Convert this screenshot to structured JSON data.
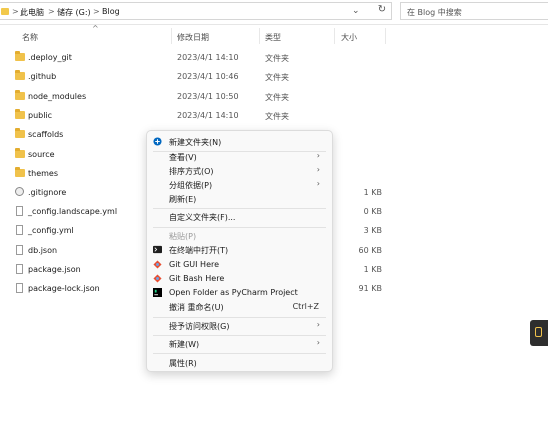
{
  "address": {
    "breadcrumbs": [
      "此电脑",
      "储存 (G:)",
      "Blog"
    ],
    "separator": ">",
    "search_placeholder": "在 Blog 中搜索"
  },
  "columns": {
    "name": "名称",
    "date": "修改日期",
    "type": "类型",
    "size": "大小"
  },
  "files": [
    {
      "name": ".deploy_git",
      "date": "2023/4/1 14:10",
      "type": "文件夹",
      "size": "",
      "kind": "folder"
    },
    {
      "name": ".github",
      "date": "2023/4/1 10:46",
      "type": "文件夹",
      "size": "",
      "kind": "folder"
    },
    {
      "name": "node_modules",
      "date": "2023/4/1 10:50",
      "type": "文件夹",
      "size": "",
      "kind": "folder"
    },
    {
      "name": "public",
      "date": "2023/4/1 14:10",
      "type": "文件夹",
      "size": "",
      "kind": "folder"
    },
    {
      "name": "scaffolds",
      "date": "",
      "type": "",
      "size": "",
      "kind": "folder"
    },
    {
      "name": "source",
      "date": "",
      "type": "",
      "size": "",
      "kind": "folder"
    },
    {
      "name": "themes",
      "date": "",
      "type": "",
      "size": "",
      "kind": "folder"
    },
    {
      "name": ".gitignore",
      "date": "",
      "type": "",
      "size": "1 KB",
      "kind": "gear"
    },
    {
      "name": "_config.landscape.yml",
      "date": "",
      "type": "",
      "size": "0 KB",
      "kind": "doc"
    },
    {
      "name": "_config.yml",
      "date": "",
      "type": "",
      "size": "3 KB",
      "kind": "doc"
    },
    {
      "name": "db.json",
      "date": "",
      "type": "",
      "size": "60 KB",
      "kind": "doc"
    },
    {
      "name": "package.json",
      "date": "",
      "type": "",
      "size": "1 KB",
      "kind": "doc"
    },
    {
      "name": "package-lock.json",
      "date": "",
      "type": "",
      "size": "91 KB",
      "kind": "doc"
    }
  ],
  "context_menu": {
    "new_folder": "新建文件夹(N)",
    "view": "查看(V)",
    "sort": "排序方式(O)",
    "group": "分组依据(P)",
    "refresh": "刷新(E)",
    "customize": "自定义文件夹(F)...",
    "paste": "粘贴(P)",
    "open_terminal": "在终端中打开(T)",
    "git_gui": "Git GUI Here",
    "git_bash": "Git Bash Here",
    "pycharm": "Open Folder as PyCharm Project",
    "undo": "撤消 重命名(U)",
    "undo_shortcut": "Ctrl+Z",
    "access": "授予访问权限(G)",
    "new": "新建(W)",
    "properties": "属性(R)"
  },
  "colors": {
    "folder": "#f0c24b",
    "accent": "#0067c0"
  }
}
